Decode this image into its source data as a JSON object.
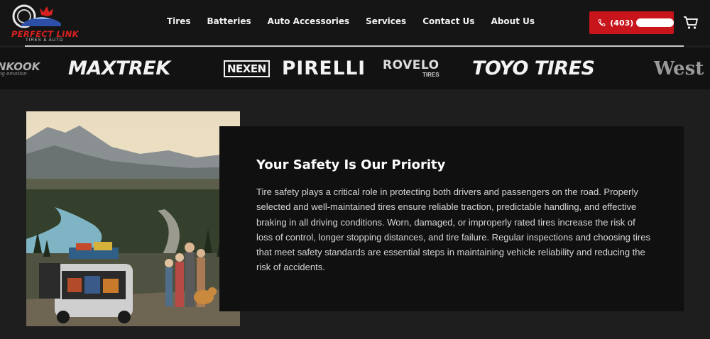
{
  "brand": {
    "name": "PERFECT LINK",
    "tagline": "TIRES & AUTO"
  },
  "nav": {
    "items": [
      {
        "label": "Tires"
      },
      {
        "label": "Batteries"
      },
      {
        "label": "Auto Accessories"
      },
      {
        "label": "Services"
      },
      {
        "label": "Contact Us"
      },
      {
        "label": "About Us"
      }
    ]
  },
  "header": {
    "phone_prefix": "(403)",
    "phone_icon": "phone-icon",
    "cart_icon": "cart-icon"
  },
  "colors": {
    "accent_red": "#c8141b",
    "background": "#1e1e1e",
    "panel": "#101010"
  },
  "brands": {
    "hankook": "NKOOK",
    "hankook_tag": "ing emotion",
    "maxtrek": "MAXTREK",
    "nexen": "NEXEN",
    "pirelli": "PIRELLI",
    "rovelo": "ROVELO",
    "rovelo_sub": "TIRES",
    "toyo": "TOYO TIRES",
    "west": "West"
  },
  "safety": {
    "title": "Your Safety Is Our Priority",
    "body": "Tire safety plays a critical role in protecting both drivers and passengers on the road. Properly selected and well-maintained tires ensure reliable traction, predictable handling, and effective braking in all driving conditions. Worn, damaged, or improperly rated tires increase the risk of loss of control, longer stopping distances, and tire failure. Regular inspections and choosing tires that meet safety standards are essential steps in maintaining vehicle reliability and reducing the risk of accidents."
  }
}
